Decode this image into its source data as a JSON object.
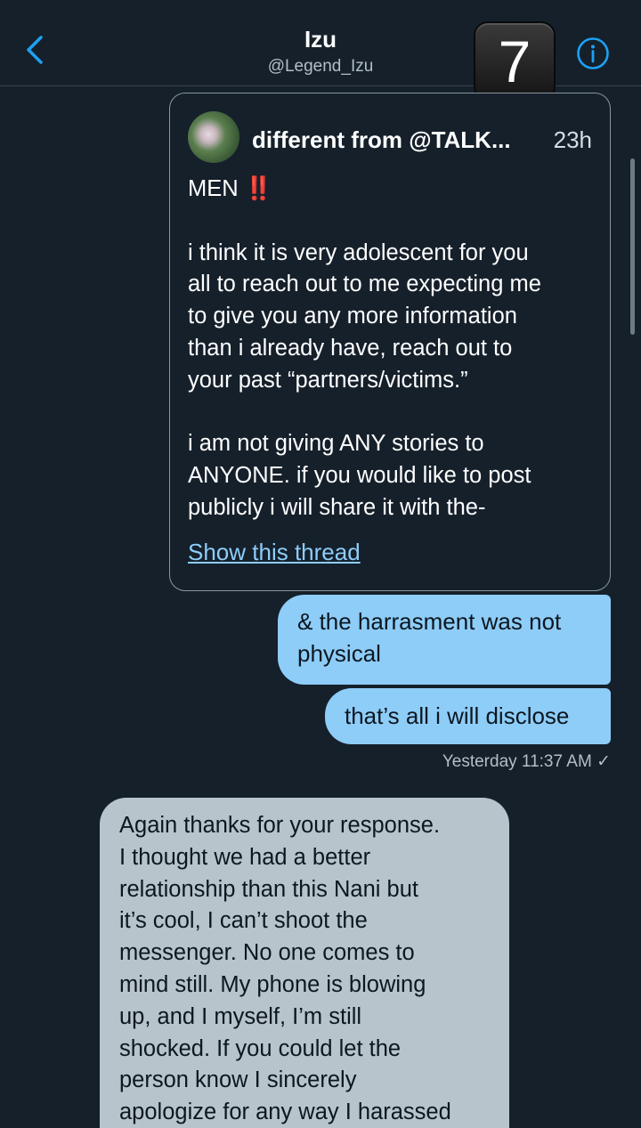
{
  "header": {
    "title": "Izu",
    "handle": "@Legend_Izu",
    "badge": "7"
  },
  "quoted_tweet": {
    "author": "different from @TALK...",
    "time": "23h",
    "line1": "MEN",
    "emoji": "‼️",
    "para1": [
      "i think it is very adolescent for you",
      "all to reach out to me expecting me",
      "to give you any more information",
      "than i already have, reach out to",
      "your past “partners/victims.”"
    ],
    "para2": [
      "i am not giving ANY stories to",
      "ANYONE. if you would like to post",
      "publicly i will share it with the-"
    ],
    "link": "Show this thread"
  },
  "messages_out": [
    {
      "lines": [
        "& the harrasment was not",
        "physical"
      ]
    },
    {
      "lines": [
        "that’s all i will disclose"
      ]
    }
  ],
  "receipt": "Yesterday 11:37 AM ✓",
  "message_in": {
    "lines": [
      "Again thanks for your response.",
      "I thought we had a better",
      "relationship than this Nani but",
      "it’s cool, I can’t shoot the",
      "messenger. No one comes to",
      "mind still. My phone is blowing",
      "up, and I myself, I’m still",
      "shocked. If you could let the",
      "person know I sincerely",
      "apologize for any way I harassed"
    ]
  },
  "colors": {
    "background": "#15202b",
    "accent": "#1da1f2",
    "bubble_out": "#8ecdf8",
    "bubble_in": "#b8c4cc"
  },
  "icons": [
    "back-chevron-icon",
    "info-icon"
  ]
}
